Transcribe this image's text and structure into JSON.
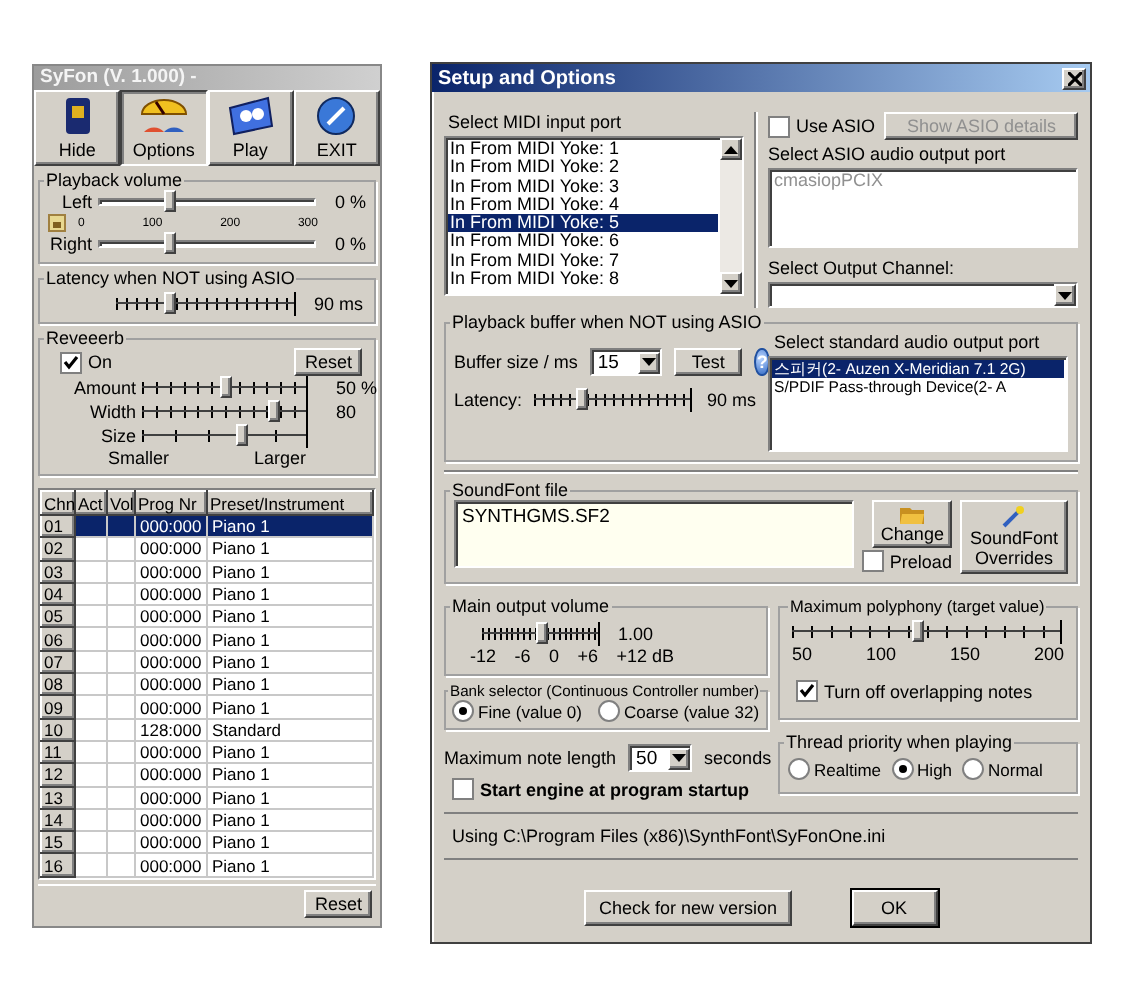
{
  "syfon": {
    "title": "SyFon (V. 1.000) -",
    "toolbar": [
      {
        "label": "Hide",
        "kind": "hide",
        "selected": false
      },
      {
        "label": "Options",
        "kind": "options",
        "selected": true
      },
      {
        "label": "Play",
        "kind": "play",
        "selected": false
      },
      {
        "label": "EXIT",
        "kind": "exit",
        "selected": false
      }
    ],
    "playback_volume": {
      "title": "Playback volume",
      "scale": [
        "0",
        "100",
        "200",
        "300"
      ],
      "channels": [
        {
          "label": "Left",
          "level": 0.33,
          "reading": "0 %"
        },
        {
          "label": "Right",
          "level": 0.33,
          "reading": "0 %"
        }
      ]
    },
    "latency": {
      "title": "Latency when NOT using ASIO",
      "level": 0.3,
      "reading": "90 ms"
    },
    "reverb": {
      "title": "Reveeerb",
      "on": {
        "label": "On",
        "checked": true
      },
      "reset": "Reset",
      "sliders": [
        {
          "label": "Amount",
          "level": 0.5,
          "reading": "50 %"
        },
        {
          "label": "Width",
          "level": 0.8,
          "reading": "80"
        },
        {
          "label": "Size",
          "level": 0.6
        }
      ],
      "size_min": "Smaller",
      "size_max": "Larger"
    },
    "table": {
      "columns": [
        "Chn",
        "Act",
        "Vol",
        "Prog Nr",
        "Preset/Instrument"
      ],
      "rows": [
        {
          "chn": "01",
          "prog": "000:000",
          "preset": "Piano 1",
          "selected": true
        },
        {
          "chn": "02",
          "prog": "000:000",
          "preset": "Piano 1",
          "selected": false
        },
        {
          "chn": "03",
          "prog": "000:000",
          "preset": "Piano 1",
          "selected": false
        },
        {
          "chn": "04",
          "prog": "000:000",
          "preset": "Piano 1",
          "selected": false
        },
        {
          "chn": "05",
          "prog": "000:000",
          "preset": "Piano 1",
          "selected": false
        },
        {
          "chn": "06",
          "prog": "000:000",
          "preset": "Piano 1",
          "selected": false
        },
        {
          "chn": "07",
          "prog": "000:000",
          "preset": "Piano 1",
          "selected": false
        },
        {
          "chn": "08",
          "prog": "000:000",
          "preset": "Piano 1",
          "selected": false
        },
        {
          "chn": "09",
          "prog": "000:000",
          "preset": "Piano 1",
          "selected": false
        },
        {
          "chn": "10",
          "prog": "128:000",
          "preset": "Standard",
          "selected": false
        },
        {
          "chn": "11",
          "prog": "000:000",
          "preset": "Piano 1",
          "selected": false
        },
        {
          "chn": "12",
          "prog": "000:000",
          "preset": "Piano 1",
          "selected": false
        },
        {
          "chn": "13",
          "prog": "000:000",
          "preset": "Piano 1",
          "selected": false
        },
        {
          "chn": "14",
          "prog": "000:000",
          "preset": "Piano 1",
          "selected": false
        },
        {
          "chn": "15",
          "prog": "000:000",
          "preset": "Piano 1",
          "selected": false
        },
        {
          "chn": "16",
          "prog": "000:000",
          "preset": "Piano 1",
          "selected": false
        }
      ]
    },
    "reset": "Reset"
  },
  "setup": {
    "title": "Setup and Options",
    "midi_input": {
      "title": "Select MIDI input port",
      "items": [
        {
          "label": "In From MIDI Yoke:  1",
          "selected": false
        },
        {
          "label": "In From MIDI Yoke:  2",
          "selected": false
        },
        {
          "label": "In From MIDI Yoke:  3",
          "selected": false
        },
        {
          "label": "In From MIDI Yoke:  4",
          "selected": false
        },
        {
          "label": "In From MIDI Yoke:  5",
          "selected": true
        },
        {
          "label": "In From MIDI Yoke:  6",
          "selected": false
        },
        {
          "label": "In From MIDI Yoke:  7",
          "selected": false
        },
        {
          "label": "In From MIDI Yoke:  8",
          "selected": false
        }
      ]
    },
    "use_asio": {
      "label": "Use ASIO",
      "checked": false
    },
    "show_asio_details": {
      "label": "Show ASIO details",
      "disabled": true
    },
    "asio_port": {
      "title": "Select ASIO audio output port",
      "items": [
        "cmasiopPCIX"
      ],
      "disabled": true
    },
    "output_channel": {
      "title": "Select Output Channel:"
    },
    "playback_buffer": {
      "title": "Playback buffer when NOT using ASIO",
      "buffer_label": "Buffer size / ms",
      "buffer_value": "15",
      "test": "Test",
      "help": "?",
      "latency_label": "Latency:",
      "level": 0.3,
      "reading": "90 ms"
    },
    "audio_output": {
      "title": "Select standard audio output port",
      "items": [
        {
          "label": "스피커(2- Auzen X-Meridian 7.1 2G)",
          "selected": true
        },
        {
          "label": "S/PDIF Pass-through Device(2- A",
          "selected": false
        }
      ]
    },
    "soundfont": {
      "title": "SoundFont file",
      "file": "SYNTHGMS.SF2",
      "change": "Change",
      "preload": {
        "label": "Preload",
        "checked": false
      },
      "overrides": "SoundFont Overrides"
    },
    "main_volume": {
      "title": "Main output volume",
      "level": 0.5,
      "reading": "1.00",
      "scale": [
        "-12",
        "-6",
        "0",
        "+6",
        "+12 dB"
      ]
    },
    "polyphony": {
      "title": "Maximum polyphony (target value)",
      "level": 0.47,
      "scale": [
        "50",
        "100",
        "150",
        "200"
      ],
      "overlap": {
        "label": "Turn off overlapping notes",
        "checked": true
      }
    },
    "bank_selector": {
      "title": "Bank selector (Continuous Controller number)",
      "options": [
        {
          "label": "Fine (value 0)",
          "selected": true
        },
        {
          "label": "Coarse (value 32)",
          "selected": false
        }
      ]
    },
    "note_length": {
      "label": "Maximum note length",
      "value": "50",
      "unit": "seconds"
    },
    "start_engine": {
      "label": "Start engine at program startup",
      "checked": false
    },
    "thread_priority": {
      "title": "Thread priority when playing",
      "options": [
        {
          "label": "Realtime",
          "selected": false
        },
        {
          "label": "High",
          "selected": true
        },
        {
          "label": "Normal",
          "selected": false
        }
      ]
    },
    "status": "Using C:\\Program Files (x86)\\SynthFont\\SyFonOne.ini",
    "buttons": [
      "Check for new version",
      "OK"
    ]
  }
}
